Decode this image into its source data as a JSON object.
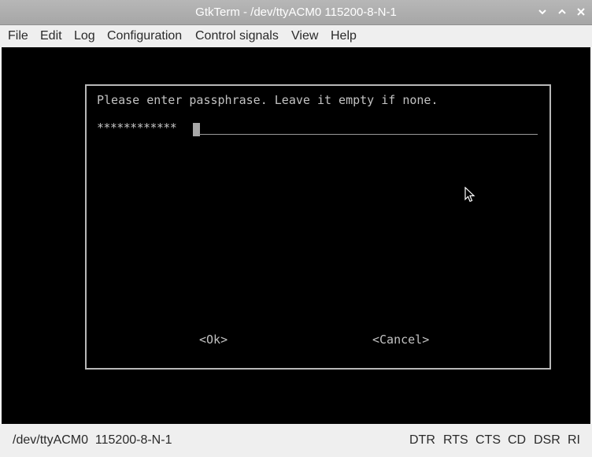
{
  "window": {
    "title": "GtkTerm - /dev/ttyACM0  115200-8-N-1",
    "controls": [
      "chevron-down-icon",
      "chevron-up-icon",
      "close-icon"
    ]
  },
  "menu": {
    "items": [
      "File",
      "Edit",
      "Log",
      "Configuration",
      "Control signals",
      "View",
      "Help"
    ]
  },
  "terminal": {
    "prompt": "Please enter passphrase. Leave it empty if none.",
    "password_mask": "************",
    "ok_label": "<Ok>",
    "cancel_label": "<Cancel>",
    "background_color": "#000000",
    "text_color": "#c2c2c2"
  },
  "status": {
    "port_info": "/dev/ttyACM0  115200-8-N-1",
    "signals": [
      "DTR",
      "RTS",
      "CTS",
      "CD",
      "DSR",
      "RI"
    ]
  }
}
